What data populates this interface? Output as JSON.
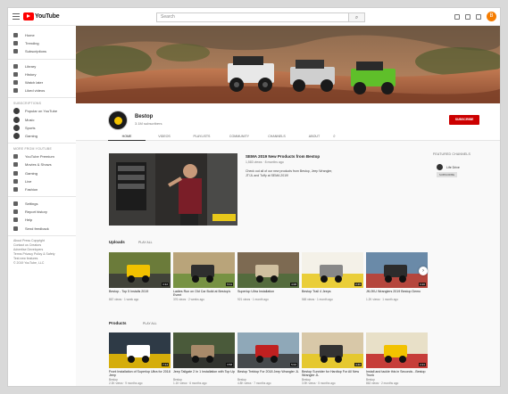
{
  "topbar": {
    "logo": "YouTube",
    "search_placeholder": "Search",
    "avatar_letter": "B"
  },
  "sidebar": {
    "main": [
      {
        "label": "Home",
        "icon": "home-icon"
      },
      {
        "label": "Trending",
        "icon": "fire-icon"
      },
      {
        "label": "Subscriptions",
        "icon": "subscriptions-icon"
      }
    ],
    "library": [
      {
        "label": "Library",
        "icon": "library-icon"
      },
      {
        "label": "History",
        "icon": "history-icon"
      },
      {
        "label": "Watch later",
        "icon": "clock-icon"
      },
      {
        "label": "Liked videos",
        "icon": "thumb-up-icon"
      }
    ],
    "subscriptions_heading": "SUBSCRIPTIONS",
    "subscriptions": [
      {
        "label": "Popular on YouTube"
      },
      {
        "label": "Music"
      },
      {
        "label": "Sports"
      },
      {
        "label": "Gaming"
      }
    ],
    "more_heading": "MORE FROM YOUTUBE",
    "more": [
      {
        "label": "YouTube Premium",
        "icon": "premium-icon"
      },
      {
        "label": "Movies & Shows",
        "icon": "film-icon"
      },
      {
        "label": "Gaming",
        "icon": "gamepad-icon"
      },
      {
        "label": "Live",
        "icon": "live-icon"
      },
      {
        "label": "Fashion",
        "icon": "hanger-icon"
      }
    ],
    "settings": [
      {
        "label": "Settings",
        "icon": "gear-icon"
      },
      {
        "label": "Report history",
        "icon": "flag-icon"
      },
      {
        "label": "Help",
        "icon": "help-icon"
      },
      {
        "label": "Send feedback",
        "icon": "feedback-icon"
      }
    ],
    "footer": [
      "About Press Copyright",
      "Contact us Creators",
      "Advertise Developers",
      "Terms Privacy Policy & Safety",
      "Test new features",
      "© 2019 YouTube, LLC"
    ]
  },
  "channel": {
    "name": "Bestop",
    "subscribers": "3.1M subscribers",
    "subscribe_label": "SUBSCRIBE",
    "tabs": [
      "HOME",
      "VIDEOS",
      "PLAYLISTS",
      "COMMUNITY",
      "CHANNELS",
      "ABOUT"
    ]
  },
  "featured": {
    "title": "SEMA 2019 New Products from Bestop",
    "meta": "1,583 views · 8 months ago",
    "desc1": "Check out all of our new products from Bestop, Jeep Wrangler,",
    "desc2": "JT/JL and Tuffy at SEMA 2019!"
  },
  "right_col": {
    "title": "FEATURED CHANNELS",
    "channel": "Life Drive",
    "button": "SUBSCRIBE"
  },
  "rows": [
    {
      "title": "Uploads",
      "play_all": "PLAY ALL",
      "cards": [
        {
          "title": "Bestop - Top 5 Installs 2019",
          "meta": "867 views · 1 week ago",
          "duration": "3:32"
        },
        {
          "title": "Ladies Run on Old Car Build at Bestop's Event",
          "meta": "376 views · 2 weeks ago",
          "duration": "5:11"
        },
        {
          "title": "Superlop Ultra Installation",
          "meta": "921 views · 1 month ago",
          "duration": "4:08"
        },
        {
          "title": "Bestop Trail 4 Jeeps",
          "meta": "565 views · 1 month ago",
          "duration": "2:45"
        },
        {
          "title": "JK/JKU Wranglers 2019 Bestop Demo",
          "meta": "1.2K views · 1 month ago",
          "duration": "6:20"
        }
      ]
    },
    {
      "title": "Products",
      "play_all": "PLAY ALL",
      "cards": [
        {
          "title": "Front Installation of Superlop Ultra for 2018 Jeep",
          "channel": "Bestop",
          "meta": "2.3K views · 9 months ago",
          "duration": "7:14"
        },
        {
          "title": "Jeep Tailgate 2 In 1 Installation with Top Up",
          "channel": "Bestop",
          "meta": "1.1K views · 6 months ago",
          "duration": "3:58"
        },
        {
          "title": "Bestop Trektop For 2018 Jeep Wrangler JL",
          "channel": "Bestop",
          "meta": "4.8K views · 7 months ago",
          "duration": "5:02"
        },
        {
          "title": "Bestop Sunrider for Hardtop For All New Wrangler JL",
          "channel": "Bestop",
          "meta": "3.9K views · 5 months ago",
          "duration": "4:40"
        },
        {
          "title": "Install and tackle this in Seconds - Bestop Trunk",
          "channel": "Bestop",
          "meta": "862 views · 2 months ago",
          "duration": "2:21"
        }
      ]
    }
  ],
  "colors": {
    "brand_red": "#ff0000",
    "subscribe_red": "#cc0000",
    "avatar_orange": "#f57c00"
  }
}
